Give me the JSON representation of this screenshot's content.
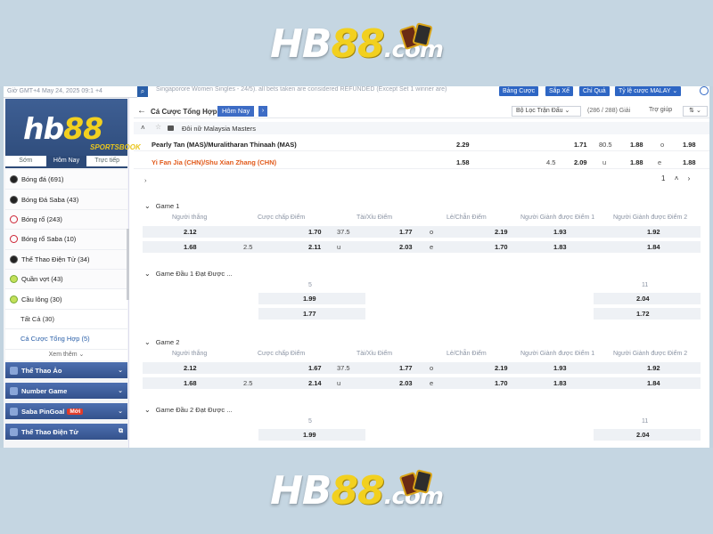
{
  "brand": {
    "logo_text_white": "HB",
    "logo_text_yellow": "88",
    "logo_text_suffix": ".com",
    "colors": {
      "primary_blue": "#2d4a78",
      "accent_orange": "#e15a1b",
      "logo_yellow": "#f2d01f"
    }
  },
  "sidebar": {
    "datetime": "Giờ GMT+4 May 24, 2025 09:1 +4",
    "search_icon": "search-icon",
    "logo_main": "hb",
    "logo_yellow": "88",
    "logo_sub": "SPORTSBOOK",
    "tabs": [
      {
        "label": "Sớm"
      },
      {
        "label": "Hôm Nay",
        "active": true
      },
      {
        "label": "Trực tiếp"
      }
    ],
    "items": [
      {
        "label": "Bóng đá",
        "count": "(691)",
        "icon": "soccer-ball-icon"
      },
      {
        "label": "Bóng Đá Saba",
        "count": "(43)",
        "icon": "soccer-ball-icon"
      },
      {
        "label": "Bóng rổ",
        "count": "(243)",
        "icon": "basketball-icon"
      },
      {
        "label": "Bóng rổ Saba",
        "count": "(10)",
        "icon": "basketball-icon"
      },
      {
        "label": "Thể Thao Điện Tử",
        "count": "(34)",
        "icon": "esports-icon"
      },
      {
        "label": "Quần vợt",
        "count": "(43)",
        "icon": "tennis-icon"
      },
      {
        "label": "Cầu lông",
        "count": "(30)",
        "icon": "badminton-icon",
        "active": true
      }
    ],
    "subitems": [
      {
        "label": "Tất Cả",
        "count": "(30)"
      },
      {
        "label": "Cá Cược Tổng Hợp",
        "count": "(5)",
        "active": true
      }
    ],
    "more_label": "Xem thêm",
    "sections": [
      {
        "label": "Thể Thao Ảo"
      },
      {
        "label": "Number Game"
      },
      {
        "label": "Saba PinGoal",
        "badge": "Mới"
      },
      {
        "label": "Thể Thao Điện Tử"
      }
    ]
  },
  "topbar": {
    "ticker": "Singaporore Women Singles - 24/5). all bets taken are considered REFUNDED (Except Set 1 winner are)",
    "buttons": [
      {
        "label": "Bảng Cược"
      },
      {
        "label": "Sắp Xế"
      },
      {
        "label": "Chỉ Quả"
      },
      {
        "label": "Tỷ lệ cược MALAY"
      }
    ]
  },
  "toolbar": {
    "title": "Cá Cược Tổng Hợp",
    "today": "Hôm Nay",
    "filter": "Bộ Lọc Trận Đấu",
    "count": "(286 / 288) Giải",
    "help": "Trợ giúp"
  },
  "league": {
    "name": "Đôi nữ Malaysia Masters"
  },
  "matches": [
    {
      "team": "Pearly Tan (MAS)/Muralitharan Thinaah (MAS)",
      "ml": "2.29",
      "hdp": "",
      "hdp_odds": "1.71",
      "total": "80.5",
      "total_odds": "1.88",
      "ou_label": "o",
      "oe_odds": "1.98",
      "favorite": true
    },
    {
      "team": "Yi Fan Jia (CHN)/Shu Xian Zhang (CHN)",
      "ml": "1.58",
      "hdp": "4.5",
      "hdp_odds": "2.09",
      "total": "",
      "total_odds": "1.88",
      "ou_label": "u",
      "oe_label": "e",
      "oe_odds": "1.88",
      "favorite": false
    }
  ],
  "pager": {
    "page": "1"
  },
  "game1": {
    "title": "Game 1",
    "headers": [
      "Người thắng",
      "Cược chấp Điểm",
      "Tài/Xỉu Điểm",
      "Lẻ/Chẵn Điểm",
      "Người Giành được Điểm 1",
      "Người Giành được Điểm 2"
    ],
    "rows": [
      {
        "winner": "2.12",
        "hdp_line": "",
        "hdp": "1.70",
        "ou_line": "37.5",
        "ou": "1.77",
        "oe_lbl": "o",
        "oe": "2.19",
        "p1": "1.93",
        "p2": "1.92"
      },
      {
        "winner": "1.68",
        "hdp_line": "2.5",
        "hdp": "2.11",
        "ou_line": "u",
        "ou": "2.03",
        "oe_lbl": "e",
        "oe": "1.70",
        "p1": "1.83",
        "p2": "1.84"
      }
    ]
  },
  "game1_first": {
    "title": "Game Đầu 1 Đạt Được ...",
    "col_a": "5",
    "col_b": "11",
    "rows": [
      {
        "a": "1.99",
        "b": "2.04"
      },
      {
        "a": "1.77",
        "b": "1.72"
      }
    ]
  },
  "game2": {
    "title": "Game 2",
    "headers": [
      "Người thắng",
      "Cược chấp Điểm",
      "Tài/Xỉu Điểm",
      "Lẻ/Chẵn Điểm",
      "Người Giành được Điểm 1",
      "Người Giành được Điểm 2"
    ],
    "rows": [
      {
        "winner": "2.12",
        "hdp_line": "",
        "hdp": "1.67",
        "ou_line": "37.5",
        "ou": "1.77",
        "oe_lbl": "o",
        "oe": "2.19",
        "p1": "1.93",
        "p2": "1.92"
      },
      {
        "winner": "1.68",
        "hdp_line": "2.5",
        "hdp": "2.14",
        "ou_line": "u",
        "ou": "2.03",
        "oe_lbl": "e",
        "oe": "1.70",
        "p1": "1.83",
        "p2": "1.84"
      }
    ]
  },
  "game2_first": {
    "title": "Game Đầu 2 Đạt Được ...",
    "col_a": "5",
    "col_b": "11",
    "rows": [
      {
        "a": "1.99",
        "b": "2.04"
      }
    ]
  }
}
